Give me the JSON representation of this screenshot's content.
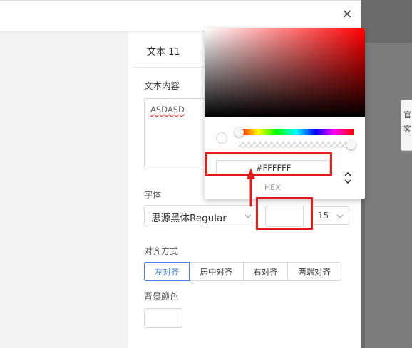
{
  "dialog": {
    "close_icon": "close-icon",
    "close_glyph": "✕"
  },
  "panel": {
    "title": "文本 11",
    "text_content_label": "文本内容",
    "text_content_value": "ASDASD",
    "font_label": "字体",
    "font_family_value": "思源黑体Regular",
    "font_color_value": "#FFFFFF",
    "font_size_value": "15",
    "align_label": "对齐方式",
    "align_options": [
      "左对齐",
      "居中对齐",
      "右对齐",
      "两端对齐"
    ],
    "align_selected": "左对齐",
    "bg_color_label": "背景颜色",
    "bg_color_value": "#FFFFFF"
  },
  "color_picker": {
    "hue_color": "#ff0000",
    "alpha": 1.0,
    "hex_value": "#FFFFFF",
    "mode_label": "HEX",
    "mode_toggle_icon": "up-down-chevron-icon"
  },
  "side_peek": {
    "glyphs": [
      "官",
      "客"
    ]
  },
  "colors": {
    "accent": "#3c7ff0",
    "annotation_red": "#e31b1b",
    "overlay_gray": "#6b6b6b"
  }
}
